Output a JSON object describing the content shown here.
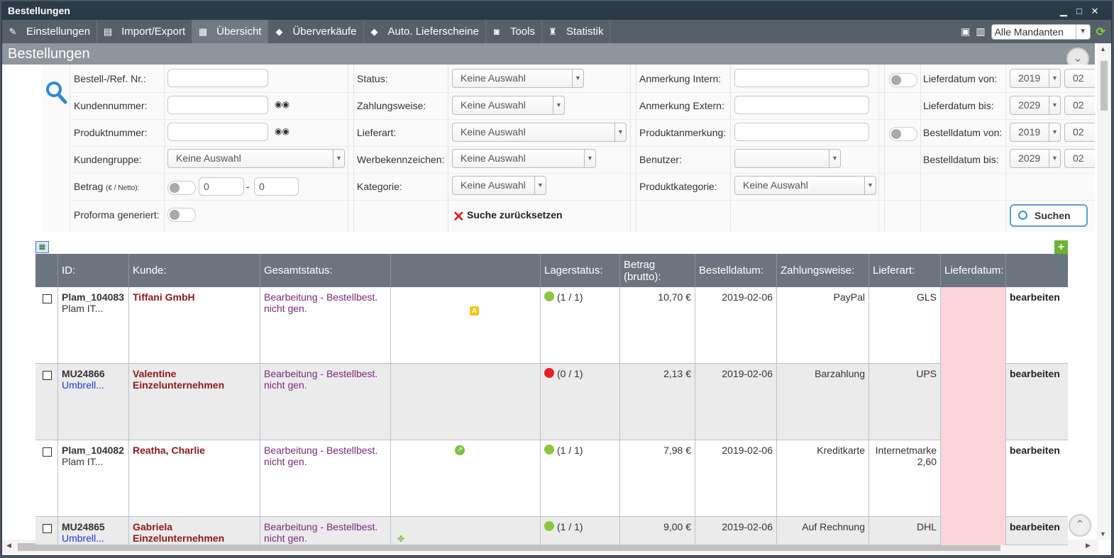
{
  "window": {
    "title": "Bestellungen"
  },
  "menu": {
    "items": [
      {
        "label": "Einstellungen",
        "icon": "settings-icon"
      },
      {
        "label": "Import/Export",
        "icon": "document-icon"
      },
      {
        "label": "Übersicht",
        "icon": "grid-icon"
      },
      {
        "label": "Überverkäufe",
        "icon": "diamond-icon"
      },
      {
        "label": "Auto. Lieferscheine",
        "icon": "diamond-icon"
      },
      {
        "label": "Tools",
        "icon": "tools-icon"
      },
      {
        "label": "Statistik",
        "icon": "statistics-icon"
      }
    ],
    "mandant_value": "Alle Mandanten"
  },
  "section": {
    "title": "Bestellungen"
  },
  "filter": {
    "bestell_ref_label": "Bestell-/Ref. Nr.:",
    "kundennummer_label": "Kundennummer:",
    "produktnummer_label": "Produktnummer:",
    "kundengruppe_label": "Kundengruppe:",
    "kundengruppe_value": "Keine Auswahl",
    "betrag_label": "Betrag",
    "betrag_sub": "(€ / Netto):",
    "betrag_from": "0",
    "betrag_sep": "-",
    "betrag_to": "0",
    "proforma_label": "Proforma generiert:",
    "status_label": "Status:",
    "status_value": "Keine Auswahl",
    "zahlungsweise_label": "Zahlungsweise:",
    "zahlungsweise_value": "Keine Auswahl",
    "lieferart_label": "Lieferart:",
    "lieferart_value": "Keine Auswahl",
    "werbekennzeichen_label": "Werbekennzeichen:",
    "werbekennzeichen_value": "Keine Auswahl",
    "kategorie_label": "Kategorie:",
    "kategorie_value": "Keine Auswahl",
    "reset_label": "Suche zurücksetzen",
    "anmerkung_intern_label": "Anmerkung Intern:",
    "anmerkung_extern_label": "Anmerkung Extern:",
    "produktanmerkung_label": "Produktanmerkung:",
    "benutzer_label": "Benutzer:",
    "produktkategorie_label": "Produktkategorie:",
    "produktkategorie_value": "Keine Auswahl",
    "lieferdatum_von_label": "Lieferdatum von:",
    "lieferdatum_bis_label": "Lieferdatum bis:",
    "bestelldatum_von_label": "Bestelldatum von:",
    "bestelldatum_bis_label": "Bestelldatum bis:",
    "lieferdatum_von_year": "2019",
    "lieferdatum_von_month": "02",
    "lieferdatum_bis_year": "2029",
    "lieferdatum_bis_month": "02",
    "bestelldatum_von_year": "2019",
    "bestelldatum_von_month": "02",
    "bestelldatum_bis_year": "2029",
    "bestelldatum_bis_month": "02",
    "search_button": "Suchen"
  },
  "table": {
    "headers": {
      "id": "ID:",
      "kunde": "Kunde:",
      "gesamtstatus": "Gesamtstatus:",
      "lagerstatus": "Lagerstatus:",
      "betrag": "Betrag (brutto):",
      "bestelldatum": "Bestelldatum:",
      "zahlungsweise": "Zahlungsweise:",
      "lieferart": "Lieferart:",
      "lieferdatum": "Lieferdatum:"
    },
    "rows": [
      {
        "id": "Plam_104083",
        "sub": "Plam IT...",
        "kunde": "Tiffani GmbH",
        "status": "Bearbeitung - Bestellbest. nicht gen.",
        "lager_color": "#8cc63f",
        "lager": "(1 / 1)",
        "betrag": "10,70 €",
        "datum": "2019-02-06",
        "zahlung": "PayPal",
        "lieferart": "GLS",
        "edit": "bearbeiten",
        "marker": "A"
      },
      {
        "id": "MU24866",
        "sub": "Umbrell...",
        "kunde": "Valentine Einzelunternehmen",
        "status": "Bearbeitung - Bestellbest. nicht gen.",
        "lager_color": "#e8202a",
        "lager": "(0 / 1)",
        "betrag": "2,13 €",
        "datum": "2019-02-06",
        "zahlung": "Barzahlung",
        "lieferart": "UPS",
        "edit": "bearbeiten",
        "marker": ""
      },
      {
        "id": "Plam_104082",
        "sub": "Plam IT...",
        "kunde": "Reatha, Charlie",
        "status": "Bearbeitung - Bestellbest. nicht gen.",
        "lager_color": "#8cc63f",
        "lager": "(1 / 1)",
        "betrag": "7,98 €",
        "datum": "2019-02-06",
        "zahlung": "Kreditkarte",
        "lieferart": "Internetmarke 2,60",
        "edit": "bearbeiten",
        "marker": ""
      },
      {
        "id": "MU24865",
        "sub": "Umbrell...",
        "kunde": "Gabriela Einzelunternehmen",
        "status": "Bearbeitung - Bestellbest. nicht gen.",
        "lager_color": "#8cc63f",
        "lager": "(1 / 1)",
        "betrag": "9,00 €",
        "datum": "2019-02-06",
        "zahlung": "Auf Rechnung",
        "lieferart": "DHL",
        "edit": "bearbeiten",
        "marker": ""
      }
    ]
  }
}
